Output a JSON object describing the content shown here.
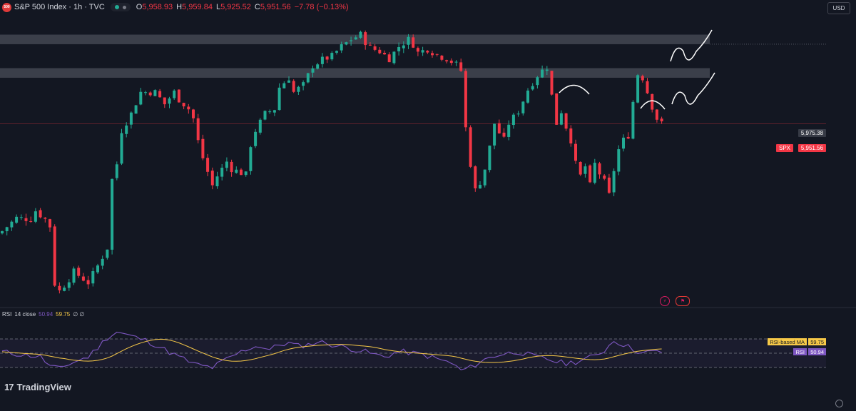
{
  "header": {
    "logo_text": "500",
    "symbol": "S&P 500 Index · 1h · TVC",
    "ohlc": [
      {
        "label": "O",
        "value": "5,958.93"
      },
      {
        "label": "H",
        "value": "5,959.84"
      },
      {
        "label": "L",
        "value": "5,925.52"
      },
      {
        "label": "C",
        "value": "5,951.56"
      },
      {
        "label": "",
        "value": "−7.78 (−0.13%)"
      }
    ]
  },
  "currency": "USD",
  "price_scale": {
    "level_label": "5,975.38",
    "current_symbol": "SPX",
    "current_price": "5,951.56"
  },
  "rsi": {
    "title": "RSI",
    "params": "14 close",
    "value": "50.94",
    "ma_value": "59.75",
    "extra": "∅ ∅",
    "ma_label": "RSI-based MA",
    "rsi_label": "RSI"
  },
  "branding": "TradingView",
  "colors": {
    "background": "#131722",
    "up": "#22ab94",
    "down": "#f23645",
    "zone": "#5d606b",
    "rsi_line": "#7e57c2",
    "rsi_ma": "#f7c948"
  },
  "chart_data": {
    "type": "candlestick",
    "timeframe": "1h",
    "ylim": [
      5800,
      6040
    ],
    "current_price": 5951.56,
    "key_level": 5975.38,
    "resistance_zones": [
      [
        6018,
        6026
      ],
      [
        5990,
        5998
      ]
    ],
    "close_path": [
      [
        0,
        5862
      ],
      [
        3,
        5873
      ],
      [
        6,
        5872
      ],
      [
        7,
        5879
      ],
      [
        9,
        5872
      ],
      [
        10,
        5866
      ],
      [
        11,
        5818
      ],
      [
        12,
        5812
      ],
      [
        14,
        5822
      ],
      [
        15,
        5828
      ],
      [
        18,
        5819
      ],
      [
        20,
        5833
      ],
      [
        22,
        5848
      ],
      [
        23,
        5905
      ],
      [
        24,
        5918
      ],
      [
        25,
        5946
      ],
      [
        27,
        5960
      ],
      [
        29,
        5978
      ],
      [
        32,
        5978
      ],
      [
        34,
        5968
      ],
      [
        36,
        5978
      ],
      [
        37,
        5972
      ],
      [
        39,
        5964
      ],
      [
        40,
        5956
      ],
      [
        41,
        5937
      ],
      [
        42,
        5923
      ],
      [
        44,
        5900
      ],
      [
        45,
        5908
      ],
      [
        47,
        5920
      ],
      [
        48,
        5914
      ],
      [
        51,
        5909
      ],
      [
        52,
        5934
      ],
      [
        53,
        5946
      ],
      [
        55,
        5960
      ],
      [
        57,
        5964
      ],
      [
        58,
        5982
      ],
      [
        60,
        5990
      ],
      [
        61,
        5978
      ],
      [
        63,
        5984
      ],
      [
        65,
        6000
      ],
      [
        67,
        6005
      ],
      [
        69,
        6008
      ],
      [
        71,
        6016
      ],
      [
        73,
        6022
      ],
      [
        75,
        6026
      ],
      [
        76,
        6020
      ],
      [
        77,
        6015
      ],
      [
        79,
        6012
      ],
      [
        81,
        6006
      ],
      [
        83,
        6016
      ],
      [
        85,
        6022
      ],
      [
        86,
        6018
      ],
      [
        87,
        6011
      ],
      [
        89,
        6014
      ],
      [
        91,
        6009
      ],
      [
        93,
        6006
      ],
      [
        95,
        6001
      ],
      [
        96,
        5996
      ],
      [
        97,
        5948
      ],
      [
        98,
        5918
      ],
      [
        99,
        5896
      ],
      [
        100,
        5903
      ],
      [
        101,
        5914
      ],
      [
        102,
        5932
      ],
      [
        103,
        5952
      ],
      [
        104,
        5944
      ],
      [
        105,
        5938
      ],
      [
        106,
        5952
      ],
      [
        108,
        5962
      ],
      [
        110,
        5980
      ],
      [
        112,
        5992
      ],
      [
        113,
        5996
      ],
      [
        114,
        5999
      ],
      [
        115,
        5975
      ],
      [
        116,
        5952
      ],
      [
        117,
        5962
      ],
      [
        118,
        5949
      ],
      [
        119,
        5938
      ],
      [
        120,
        5918
      ],
      [
        121,
        5908
      ],
      [
        122,
        5916
      ],
      [
        123,
        5900
      ],
      [
        124,
        5918
      ],
      [
        125,
        5910
      ],
      [
        126,
        5903
      ],
      [
        127,
        5892
      ],
      [
        128,
        5913
      ],
      [
        129,
        5930
      ],
      [
        130,
        5938
      ],
      [
        131,
        5942
      ],
      [
        132,
        5970
      ],
      [
        133,
        5993
      ],
      [
        134,
        5990
      ],
      [
        135,
        5978
      ],
      [
        136,
        5966
      ],
      [
        137,
        5956
      ],
      [
        138,
        5951.56
      ]
    ],
    "rsi_series": [
      [
        0,
        52
      ],
      [
        4,
        48
      ],
      [
        8,
        45
      ],
      [
        10,
        32
      ],
      [
        12,
        28
      ],
      [
        14,
        35
      ],
      [
        16,
        40
      ],
      [
        18,
        45
      ],
      [
        20,
        58
      ],
      [
        22,
        72
      ],
      [
        24,
        80
      ],
      [
        26,
        76
      ],
      [
        28,
        72
      ],
      [
        30,
        68
      ],
      [
        32,
        62
      ],
      [
        34,
        55
      ],
      [
        36,
        48
      ],
      [
        38,
        42
      ],
      [
        40,
        35
      ],
      [
        42,
        32
      ],
      [
        44,
        30
      ],
      [
        46,
        38
      ],
      [
        48,
        45
      ],
      [
        50,
        52
      ],
      [
        52,
        58
      ],
      [
        54,
        60
      ],
      [
        56,
        55
      ],
      [
        58,
        62
      ],
      [
        60,
        64
      ],
      [
        62,
        60
      ],
      [
        64,
        62
      ],
      [
        66,
        66
      ],
      [
        68,
        64
      ],
      [
        70,
        60
      ],
      [
        72,
        58
      ],
      [
        74,
        55
      ],
      [
        76,
        52
      ],
      [
        78,
        48
      ],
      [
        80,
        45
      ],
      [
        82,
        50
      ],
      [
        84,
        52
      ],
      [
        86,
        50
      ],
      [
        88,
        48
      ],
      [
        90,
        44
      ],
      [
        92,
        40
      ],
      [
        94,
        36
      ],
      [
        96,
        26
      ],
      [
        98,
        30
      ],
      [
        100,
        38
      ],
      [
        102,
        44
      ],
      [
        104,
        48
      ],
      [
        106,
        50
      ],
      [
        108,
        52
      ],
      [
        110,
        48
      ],
      [
        112,
        44
      ],
      [
        114,
        42
      ],
      [
        116,
        38
      ],
      [
        118,
        36
      ],
      [
        120,
        38
      ],
      [
        122,
        42
      ],
      [
        124,
        46
      ],
      [
        126,
        54
      ],
      [
        128,
        68
      ],
      [
        130,
        62
      ],
      [
        132,
        56
      ],
      [
        134,
        50
      ],
      [
        136,
        52
      ],
      [
        138,
        50.94
      ]
    ],
    "rsi_ma_value": 59.75,
    "rsi_levels": [
      70,
      50,
      30
    ]
  }
}
